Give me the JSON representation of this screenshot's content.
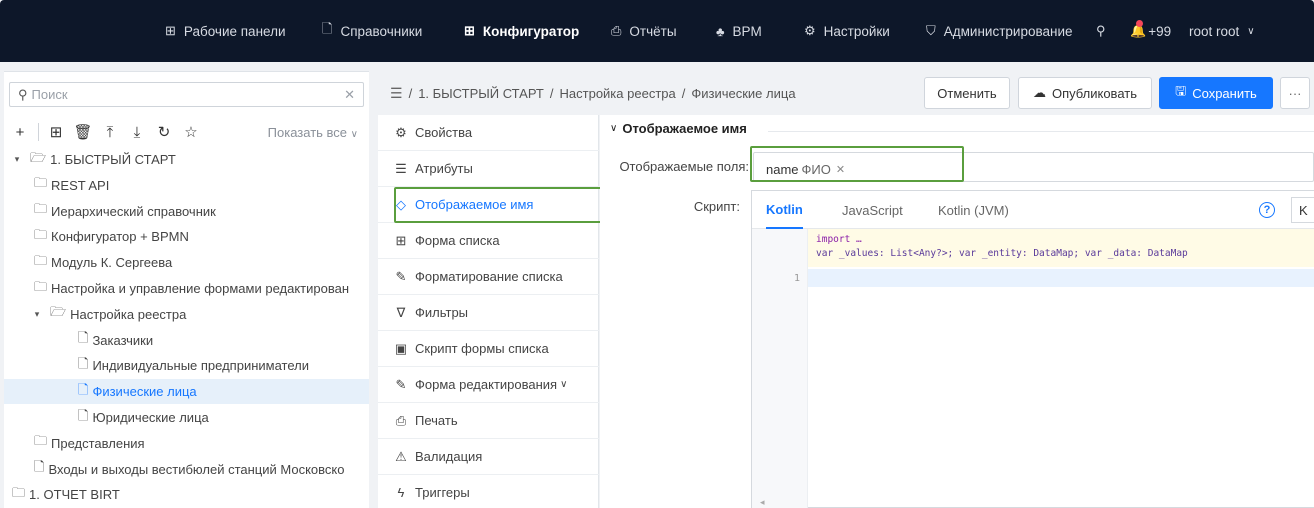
{
  "topnav": {
    "items": [
      {
        "icon": "grid-icon",
        "label": "Рабочие панели"
      },
      {
        "icon": "file-icon",
        "label": "Справочники"
      },
      {
        "icon": "grid-icon",
        "label": "Конфигуратор"
      },
      {
        "icon": "printer-icon",
        "label": "Отчёты"
      },
      {
        "icon": "bpm-icon",
        "label": "BPM"
      },
      {
        "icon": "gear-icon",
        "label": "Настройки"
      },
      {
        "icon": "shield-icon",
        "label": "Администрирование"
      }
    ],
    "active_index": 2,
    "notification_count": "+99",
    "user": "root root"
  },
  "left": {
    "search_placeholder": "Поиск",
    "show_all": "Показать все",
    "tree": [
      {
        "label": "1. БЫСТРЫЙ СТАРТ",
        "type": "folder-open",
        "level": 0,
        "caret": true
      },
      {
        "label": "REST API",
        "type": "folder",
        "level": 1
      },
      {
        "label": "Иерархический справочник",
        "type": "folder",
        "level": 1
      },
      {
        "label": "Конфигуратор + BPMN",
        "type": "folder",
        "level": 1
      },
      {
        "label": "Модуль К. Сергеева",
        "type": "folder",
        "level": 1
      },
      {
        "label": "Настройка и управление формами редактирован",
        "type": "folder",
        "level": 1
      },
      {
        "label": "Настройка реестра",
        "type": "folder-open",
        "level": 1,
        "caret": true
      },
      {
        "label": "Заказчики",
        "type": "file",
        "level": 2
      },
      {
        "label": "Индивидуальные предприниматели",
        "type": "file",
        "level": 2
      },
      {
        "label": "Физические лица",
        "type": "file",
        "level": 2,
        "selected": true
      },
      {
        "label": "Юридические лица",
        "type": "file",
        "level": 2
      },
      {
        "label": "Представления",
        "type": "folder",
        "level": 1
      },
      {
        "label": "Входы и выходы вестибюлей станций Московско",
        "type": "file",
        "level": 1
      },
      {
        "label": "1. ОТЧЕТ BIRT",
        "type": "folder",
        "level": 0
      }
    ]
  },
  "breadcrumb": {
    "items": [
      "1. БЫСТРЫЙ СТАРТ",
      "Настройка реестра",
      "Физические лица"
    ]
  },
  "actions": {
    "cancel": "Отменить",
    "publish": "Опубликовать",
    "save": "Сохранить",
    "more": "···"
  },
  "menu": {
    "items": [
      {
        "icon": "gear-icon",
        "label": "Свойства"
      },
      {
        "icon": "list-icon",
        "label": "Атрибуты"
      },
      {
        "icon": "tag-icon",
        "label": "Отображаемое имя",
        "active": true
      },
      {
        "icon": "table-icon",
        "label": "Форма списка"
      },
      {
        "icon": "brush-icon",
        "label": "Форматирование списка"
      },
      {
        "icon": "filter-icon",
        "label": "Фильтры"
      },
      {
        "icon": "terminal-icon",
        "label": "Скрипт формы списка"
      },
      {
        "icon": "edit-icon",
        "label": "Форма редактирования",
        "chevron": true
      },
      {
        "icon": "printer-icon",
        "label": "Печать"
      },
      {
        "icon": "warning-icon",
        "label": "Валидация"
      },
      {
        "icon": "lightning-icon",
        "label": "Триггеры"
      }
    ]
  },
  "content": {
    "section_title": "Отображаемое имя",
    "fields_label": "Отображаемые поля:",
    "tag": {
      "name": "name",
      "sub": "ФИО"
    },
    "script_label": "Скрипт:",
    "tabs": [
      "Kotlin",
      "JavaScript",
      "Kotlin (JVM)"
    ],
    "active_tab": 0,
    "k_button": "K",
    "code_import": "import …",
    "code_line": "var _values: List<Any?>; var _entity: DataMap; var _data: DataMap",
    "line_number": "1"
  },
  "colors": {
    "nav_bg": "#0d1729",
    "accent": "#1677ff",
    "highlight_border": "#5a9e3d"
  }
}
